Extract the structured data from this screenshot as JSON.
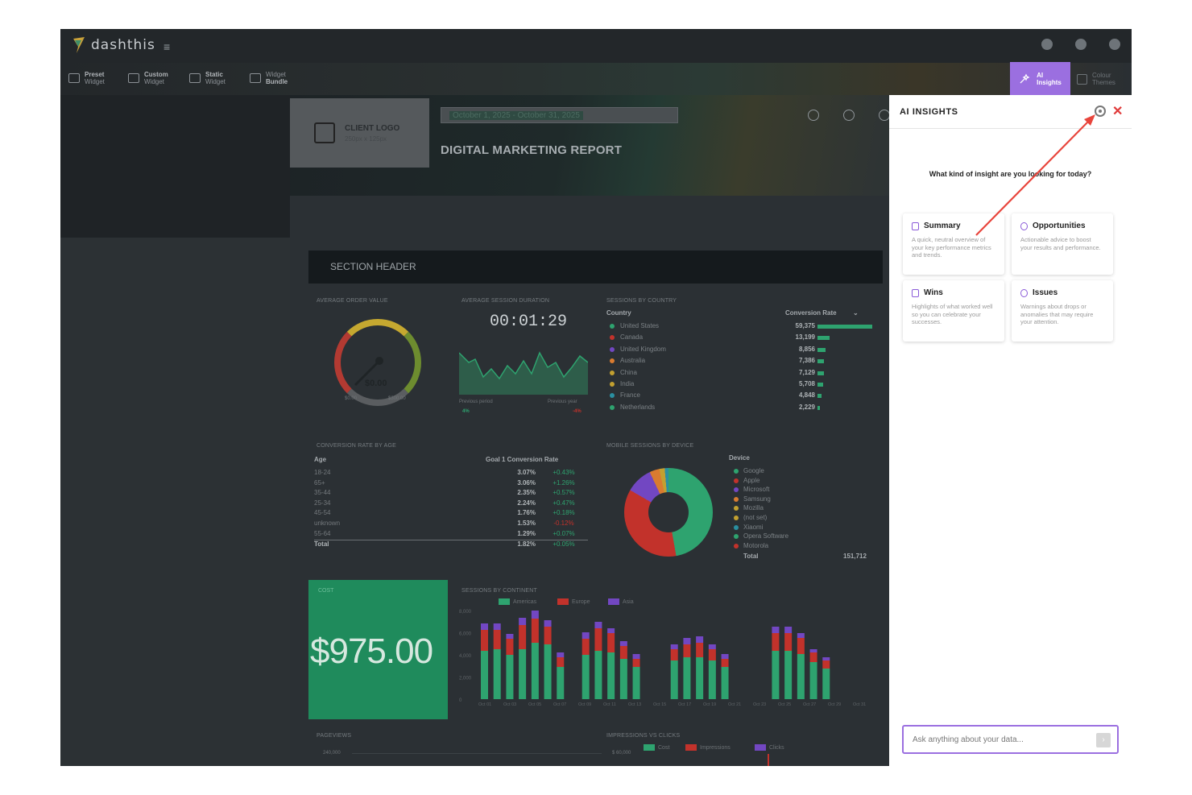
{
  "app": {
    "brand": "dashthis",
    "accent": "#9b6fe0"
  },
  "toolbar": {
    "preset": [
      "Preset",
      "Widget"
    ],
    "custom": [
      "Custom",
      "Widget"
    ],
    "static": [
      "Static",
      "Widget"
    ],
    "bundle": [
      "Widget",
      "Bundle"
    ],
    "ai": [
      "AI",
      "Insights"
    ],
    "colour": [
      "Colour",
      "Themes"
    ]
  },
  "report": {
    "client_logo": "CLIENT LOGO",
    "client_logo_size": "250px x 125px",
    "date_range": "October 1, 2025 - October 31, 2025",
    "title": "DIGITAL MARKETING REPORT",
    "section_header": "SECTION HEADER"
  },
  "widgets": {
    "aov": {
      "title": "AVERAGE ORDER VALUE",
      "value": "$0.00",
      "min": "$0.00",
      "max": "$300.00"
    },
    "duration": {
      "title": "AVERAGE SESSION DURATION",
      "value": "00:01:29",
      "prev_period": "Previous period",
      "prev_year": "Previous year",
      "delta_period": "4%",
      "delta_year": "-4%"
    },
    "country": {
      "title": "SESSIONS BY COUNTRY",
      "col_country": "Country",
      "col_rate": "Conversion Rate",
      "rows": [
        {
          "name": "United States",
          "value": "59,375",
          "color": "#2ea36f",
          "share": 1.0
        },
        {
          "name": "Canada",
          "value": "13,199",
          "color": "#c2322b",
          "share": 0.22
        },
        {
          "name": "United Kingdom",
          "value": "8,856",
          "color": "#7247c2",
          "share": 0.15
        },
        {
          "name": "Australia",
          "value": "7,386",
          "color": "#d97b30",
          "share": 0.12
        },
        {
          "name": "China",
          "value": "7,129",
          "color": "#c2a030",
          "share": 0.12
        },
        {
          "name": "India",
          "value": "5,708",
          "color": "#c2a030",
          "share": 0.1
        },
        {
          "name": "France",
          "value": "4,848",
          "color": "#2a8fa0",
          "share": 0.08
        },
        {
          "name": "Netherlands",
          "value": "2,229",
          "color": "#2ea36f",
          "share": 0.04
        }
      ]
    },
    "age": {
      "title": "CONVERSION RATE BY AGE",
      "col_age": "Age",
      "col_rate": "Goal 1 Conversion Rate",
      "rows": [
        {
          "age": "18-24",
          "rate": "3.07%",
          "delta": "+0.43%"
        },
        {
          "age": "65+",
          "rate": "3.06%",
          "delta": "+1.26%"
        },
        {
          "age": "35-44",
          "rate": "2.35%",
          "delta": "+0.57%"
        },
        {
          "age": "25-34",
          "rate": "2.24%",
          "delta": "+0.47%"
        },
        {
          "age": "45-54",
          "rate": "1.76%",
          "delta": "+0.18%"
        },
        {
          "age": "unknown",
          "rate": "1.53%",
          "delta": "-0.12%"
        },
        {
          "age": "55-64",
          "rate": "1.29%",
          "delta": "+0.07%"
        },
        {
          "age": "Total",
          "rate": "1.82%",
          "delta": "+0.05%"
        }
      ]
    },
    "device": {
      "title": "MOBILE SESSIONS BY DEVICE",
      "col_device": "Device",
      "rows": [
        {
          "name": "Google",
          "color": "#2ea36f"
        },
        {
          "name": "Apple",
          "color": "#c2322b"
        },
        {
          "name": "Microsoft",
          "color": "#7247c2"
        },
        {
          "name": "Samsung",
          "color": "#d97b30"
        },
        {
          "name": "Mozilla",
          "color": "#c2a030"
        },
        {
          "name": "(not set)",
          "color": "#c2a030"
        },
        {
          "name": "Xiaomi",
          "color": "#2a8fa0"
        },
        {
          "name": "Opera Software",
          "color": "#2ea36f"
        },
        {
          "name": "Motorola",
          "color": "#c2322b"
        }
      ],
      "total_label": "Total",
      "total_value": "151,712"
    },
    "cost": {
      "title": "COST",
      "value": "$975.00"
    },
    "continent": {
      "title": "SESSIONS BY CONTINENT",
      "legend": [
        "Americas",
        "Europe",
        "Asia"
      ],
      "colors": [
        "#2ea36f",
        "#c2322b",
        "#7247c2"
      ],
      "yticks": [
        "8,000",
        "6,000",
        "4,000",
        "2,000",
        "0"
      ],
      "xticks": [
        "Oct 01",
        "Oct 03",
        "Oct 05",
        "Oct 07",
        "Oct 09",
        "Oct 11",
        "Oct 13",
        "Oct 15",
        "Oct 17",
        "Oct 19",
        "Oct 21",
        "Oct 23",
        "Oct 25",
        "Oct 27",
        "Oct 29",
        "Oct 31"
      ]
    },
    "pageviews": {
      "title": "PAGEVIEWS",
      "tick": "240,000"
    },
    "impressions": {
      "title": "IMPRESSIONS VS CLICKS",
      "tick": "$ 60,000",
      "legend": [
        "Cost",
        "Impressions",
        "Clicks"
      ]
    }
  },
  "ai_panel": {
    "title": "AI INSIGHTS",
    "question": "What kind of insight are you looking for today?",
    "cards": [
      {
        "title": "Summary",
        "desc": "A quick, neutral overview of your key performance metrics and trends."
      },
      {
        "title": "Opportunities",
        "desc": "Actionable advice to boost your results and performance."
      },
      {
        "title": "Wins",
        "desc": "Highlights of what worked well so you can celebrate your successes."
      },
      {
        "title": "Issues",
        "desc": "Warnings about drops or anomalies that may require your attention."
      }
    ],
    "ask_placeholder": "Ask anything about your data..."
  }
}
